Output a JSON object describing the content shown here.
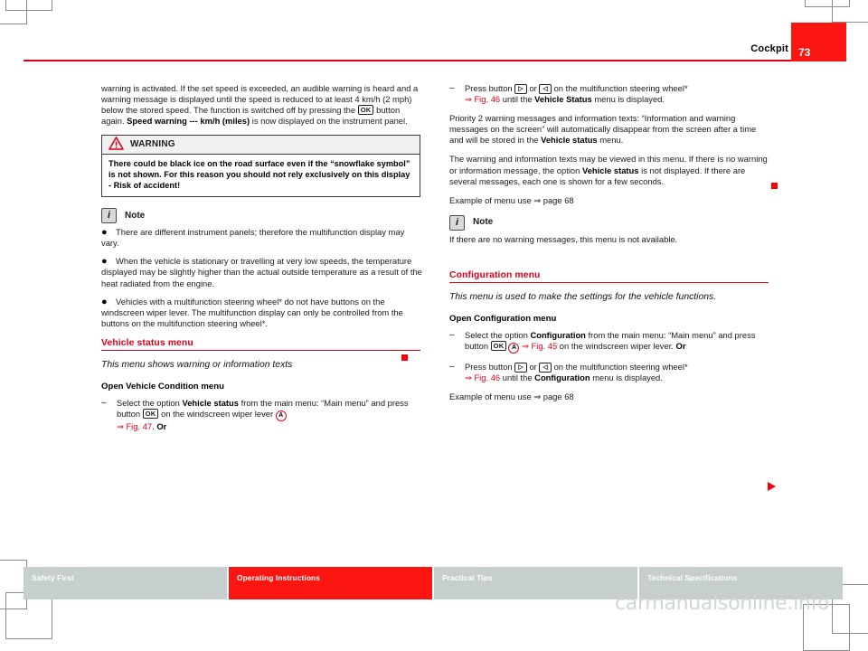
{
  "header": {
    "title": "Cockpit",
    "page_number": "73",
    "accent_color": "#e2001a",
    "page_block_color": "#fb1612"
  },
  "left_column": {
    "intro_paragraph_html": "warning is activated. If the set speed is exceeded, an audible warning is heard and a warning message is displayed until the speed is reduced to at least 4 km/h (2 mph) below the stored speed. The function is switched off by pressing the <KEY:OK> button again. <B>Speed warning --- km/h (miles)</B> is now displayed on the instrument panel.",
    "warning_box": {
      "icon": "warning-triangle-icon",
      "heading": "WARNING",
      "body": "There could be black ice on the road surface even if the “snowflake symbol” is not shown. For this reason you should not rely exclusively on this display - Risk of accident!"
    },
    "note_block": {
      "icon": "info-icon",
      "heading": "Note",
      "bullets": [
        "There are different instrument panels; therefore the multifunction display may vary.",
        "When the vehicle is stationary or travelling at very low speeds, the temperature displayed may be slightly higher than the actual outside temperature as a result of the heat radiated from the engine.",
        "Vehicles with a multifunction steering wheel* do not have buttons on the windscreen wiper lever. The multifunction display can only be controlled from the buttons on the multifunction steering wheel*."
      ],
      "end_marker": "red-square-marker"
    },
    "section": {
      "heading": "Vehicle status menu",
      "subtitle": "This menu shows warning or information texts",
      "subhead": "Open Vehicle Condition menu",
      "step": {
        "dash": "–",
        "text_part_1": "Select the option ",
        "bold_1": "Vehicle status",
        "text_part_2": " from the main menu: “Main menu” and press button ",
        "key_1": "OK",
        "text_part_3": " on the windscreen wiper lever ",
        "circled_1": "A",
        "ref": "⇒ Fig. 47",
        "text_part_4": ". ",
        "bold_2": "Or"
      }
    }
  },
  "right_column": {
    "step_top": {
      "dash": "–",
      "text_part_1": "Press button ",
      "key_1": "▷",
      "text_part_2": " or ",
      "key_2": "◁",
      "text_part_3": " on the multifunction steering wheel*",
      "ref": "⇒ Fig. 46",
      "text_part_4": " until the ",
      "bold_1": "Vehicle Status",
      "text_part_5": " menu is displayed."
    },
    "paragraph_1_part_1": "Priority 2 warning messages and information texts: “Information and warning messages on the screen” will automatically disappear from the screen after a time and will be stored in the ",
    "paragraph_1_bold": "Vehicle status",
    "paragraph_1_part_2": " menu.",
    "paragraph_2_part_1": "The warning and information texts may be viewed in this menu. If there is no warning or information message, the option ",
    "paragraph_2_bold": "Vehicle status",
    "paragraph_2_part_2": " is not displayed. If there are several messages, each one is shown for a few seconds.",
    "example_line_1": "Example of menu use ⇒ page 68",
    "note_block": {
      "icon": "info-icon",
      "heading": "Note",
      "text": "If there are no warning messages, this menu is not available.",
      "end_marker": "red-square-marker"
    },
    "section": {
      "heading": "Configuration menu",
      "subtitle": "This menu is used to make the settings for the vehicle functions.",
      "subhead": "Open Configuration menu",
      "step_1": {
        "dash": "–",
        "text_part_1": "Select the option ",
        "bold_1": "Configuration",
        "text_part_2": " from the main menu: “Main menu” and press button ",
        "key_1": "OK",
        "circled_1": "A",
        "ref": "⇒ Fig. 45",
        "text_part_3": " on the windscreen wiper lever. ",
        "bold_2": "Or"
      },
      "step_2": {
        "dash": "–",
        "text_part_1": "Press button ",
        "key_1": "▷",
        "text_part_2": " or ",
        "key_2": "◁",
        "text_part_3": " on the multifunction steering wheel*",
        "ref": "⇒ Fig. 46",
        "text_part_4": " until the ",
        "bold_1": "Configuration",
        "text_part_5": " menu is displayed."
      },
      "example_line": "Example of menu use ⇒ page 68",
      "end_marker": "red-triangle-marker"
    }
  },
  "footer": {
    "tabs": [
      {
        "label": "Safety First",
        "active": false
      },
      {
        "label": "Operating Instructions",
        "active": true
      },
      {
        "label": "Practical Tips",
        "active": false
      },
      {
        "label": "Technical Specifications",
        "active": false
      }
    ],
    "inactive_color": "#c6cfcd",
    "active_color": "#fb1612"
  },
  "watermark": "carmanualsonline.info"
}
